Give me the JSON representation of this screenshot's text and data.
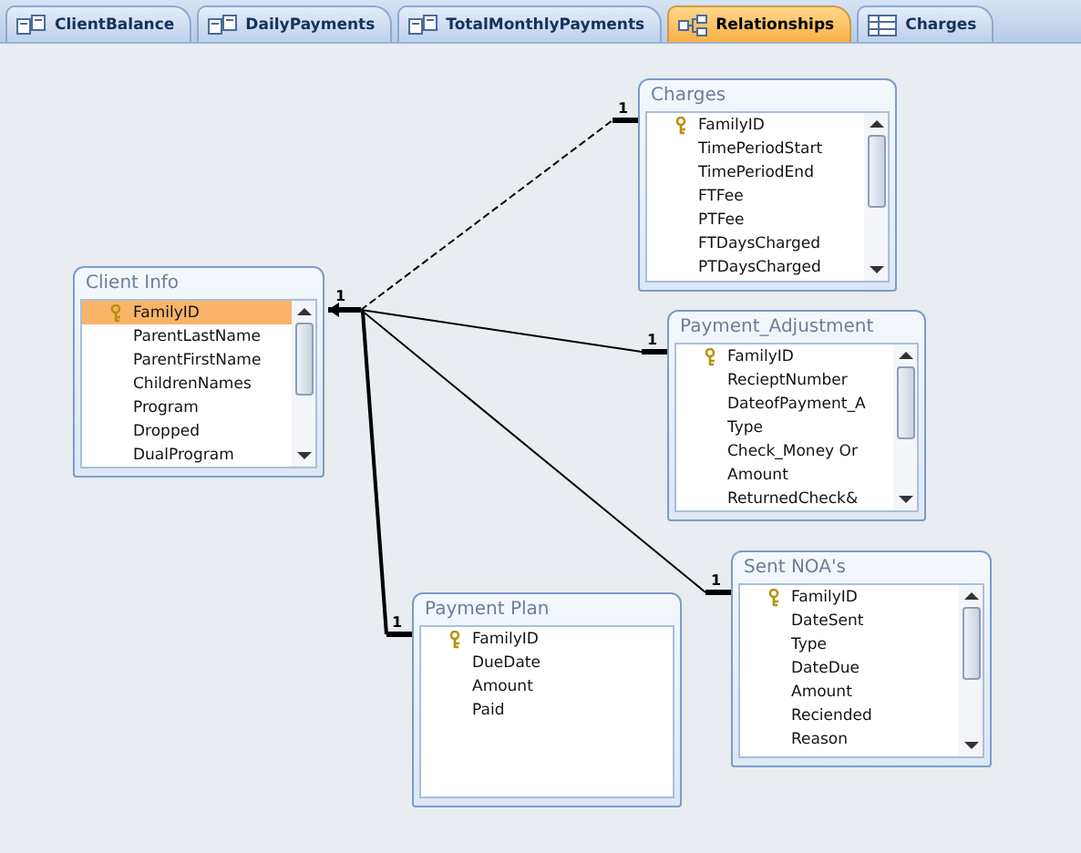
{
  "tabs": [
    {
      "label": "ClientBalance",
      "kind": "query",
      "selected": false
    },
    {
      "label": "DailyPayments",
      "kind": "query",
      "selected": false
    },
    {
      "label": "TotalMonthlyPayments",
      "kind": "query",
      "selected": false
    },
    {
      "label": "Relationships",
      "kind": "relationships",
      "selected": true
    },
    {
      "label": "Charges",
      "kind": "table",
      "selected": false
    }
  ],
  "source_label": "1",
  "tables": [
    {
      "title": "Client Info",
      "scrollbar": true,
      "fields": [
        {
          "name": "FamilyID",
          "key": true,
          "selected": true
        },
        {
          "name": "ParentLastName",
          "key": false,
          "selected": false
        },
        {
          "name": "ParentFirstName",
          "key": false,
          "selected": false
        },
        {
          "name": "ChildrenNames",
          "key": false,
          "selected": false
        },
        {
          "name": "Program",
          "key": false,
          "selected": false
        },
        {
          "name": "Dropped",
          "key": false,
          "selected": false
        },
        {
          "name": "DualProgram",
          "key": false,
          "selected": false
        }
      ]
    },
    {
      "title": "Charges",
      "scrollbar": true,
      "fields": [
        {
          "name": "FamilyID",
          "key": true,
          "selected": false
        },
        {
          "name": "TimePeriodStart",
          "key": false,
          "selected": false
        },
        {
          "name": "TimePeriodEnd",
          "key": false,
          "selected": false
        },
        {
          "name": "FTFee",
          "key": false,
          "selected": false
        },
        {
          "name": "PTFee",
          "key": false,
          "selected": false
        },
        {
          "name": "FTDaysCharged",
          "key": false,
          "selected": false
        },
        {
          "name": "PTDaysCharged",
          "key": false,
          "selected": false
        }
      ]
    },
    {
      "title": "Payment_Adjustment",
      "scrollbar": true,
      "fields": [
        {
          "name": "FamilyID",
          "key": true,
          "selected": false
        },
        {
          "name": "RecieptNumber",
          "key": false,
          "selected": false
        },
        {
          "name": "DateofPayment_A",
          "key": false,
          "selected": false
        },
        {
          "name": "Type",
          "key": false,
          "selected": false
        },
        {
          "name": "Check_Money Or",
          "key": false,
          "selected": false
        },
        {
          "name": "Amount",
          "key": false,
          "selected": false
        },
        {
          "name": "ReturnedCheck&",
          "key": false,
          "selected": false
        }
      ]
    },
    {
      "title": "Payment Plan",
      "scrollbar": false,
      "fields": [
        {
          "name": "FamilyID",
          "key": true,
          "selected": false
        },
        {
          "name": "DueDate",
          "key": false,
          "selected": false
        },
        {
          "name": "Amount",
          "key": false,
          "selected": false
        },
        {
          "name": "Paid",
          "key": false,
          "selected": false
        }
      ]
    },
    {
      "title": "Sent NOA's",
      "scrollbar": true,
      "fields": [
        {
          "name": "FamilyID",
          "key": true,
          "selected": false
        },
        {
          "name": "DateSent",
          "key": false,
          "selected": false
        },
        {
          "name": "Type",
          "key": false,
          "selected": false
        },
        {
          "name": "DateDue",
          "key": false,
          "selected": false
        },
        {
          "name": "Amount",
          "key": false,
          "selected": false
        },
        {
          "name": "Reciended",
          "key": false,
          "selected": false
        },
        {
          "name": "Reason",
          "key": false,
          "selected": false
        }
      ]
    }
  ],
  "relationships": [
    {
      "label": "1"
    },
    {
      "label": "1"
    },
    {
      "label": "1"
    },
    {
      "label": "1"
    }
  ]
}
